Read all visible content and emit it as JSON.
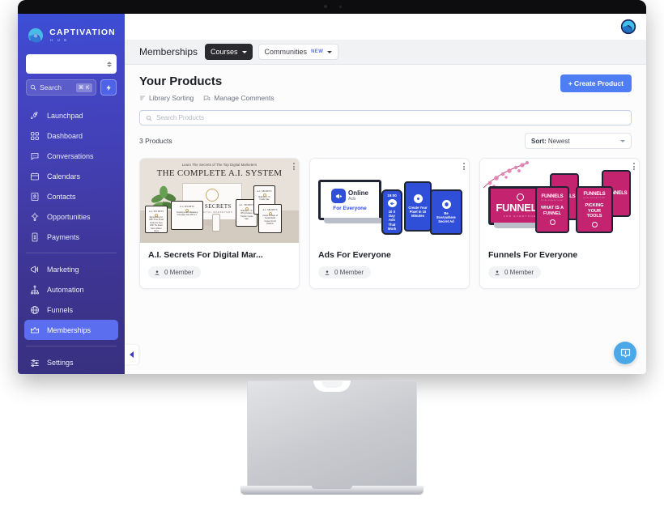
{
  "sidebar": {
    "brand": {
      "name": "CAPTIVATION",
      "sub": "H U B",
      "logo_icon": "captivation-leaf-logo"
    },
    "org_select": {
      "value": "",
      "icon": "spinner-arrows-icon"
    },
    "search": {
      "label": "Search",
      "shortcut": "⌘ K",
      "icon": "search-icon"
    },
    "quick_action": {
      "icon": "lightning-bolt-icon"
    },
    "items": [
      {
        "label": "Launchpad",
        "icon": "rocket-icon",
        "active": false
      },
      {
        "label": "Dashboard",
        "icon": "grid-icon",
        "active": false
      },
      {
        "label": "Conversations",
        "icon": "chat-bubble-icon",
        "active": false
      },
      {
        "label": "Calendars",
        "icon": "calendar-icon",
        "active": false
      },
      {
        "label": "Contacts",
        "icon": "contact-card-icon",
        "active": false
      },
      {
        "label": "Opportunities",
        "icon": "target-bulb-icon",
        "active": false
      },
      {
        "label": "Payments",
        "icon": "payment-icon",
        "active": false
      }
    ],
    "items2": [
      {
        "label": "Marketing",
        "icon": "megaphone-icon",
        "active": false
      },
      {
        "label": "Automation",
        "icon": "workflow-icon",
        "active": false
      },
      {
        "label": "Funnels",
        "icon": "globe-icon",
        "active": false
      },
      {
        "label": "Memberships",
        "icon": "crown-icon",
        "active": true
      }
    ],
    "items3": [
      {
        "label": "Settings",
        "icon": "sliders-icon",
        "active": false
      }
    ],
    "active_color": "#5b6ef0"
  },
  "topbar": {
    "app_logo_icon": "captivation-circle-logo"
  },
  "tabbar": {
    "title": "Memberships",
    "tabs": [
      {
        "label": "Courses",
        "active": true,
        "badge": "",
        "icon": "chevron-down-icon"
      },
      {
        "label": "Communities",
        "active": false,
        "badge": "NEW",
        "icon": "chevron-down-icon"
      }
    ]
  },
  "page": {
    "title": "Your Products",
    "sub_actions": [
      {
        "label": "Library Sorting",
        "icon": "library-sort-icon"
      },
      {
        "label": "Manage Comments",
        "icon": "comments-icon"
      }
    ],
    "create_button": "+ Create Product",
    "search_placeholder": "Search Products",
    "search_value": "",
    "search_icon": "search-icon",
    "count_label": "3 Products",
    "sort": {
      "prefix": "Sort:",
      "value": "Newest",
      "icon": "chevron-down-icon"
    }
  },
  "products": [
    {
      "title": "A.I. Secrets For Digital Mar...",
      "members": "0 Member",
      "member_icon": "person-icon",
      "menu_icon": "more-vertical-icon",
      "thumb": {
        "style": "ai-system",
        "kicker": "Learn The Secrets of The Top Digital Marketers",
        "headline": "THE COMPLETE A.I. SYSTEM",
        "monitor_title": "A.I. SECRETS",
        "monitor_sub": "FOR DIGITAL MARKETERS",
        "tablets": [
          {
            "title": "A.I. SECRETS",
            "body": "Skyrocketing A.I. With Three Small Clicks For Sure With The Exact Same Master Alerts"
          },
          {
            "title": "A.I. SECRETS",
            "body": "Creating Leads Marketing Campaign Fast With A.I."
          },
          {
            "title": "A.I. SECRETS",
            "body": "Making A.I. To Wing Creative Traction Create Sale"
          },
          {
            "title": "A.I. SECRETS",
            "body": "Making A.I. To Create Sale"
          },
          {
            "title": "A.I. SECRETS",
            "body": "Create 30 Days of Social Media Content for All Platform"
          }
        ]
      }
    },
    {
      "title": "Ads For Everyone",
      "members": "0 Member",
      "member_icon": "person-icon",
      "menu_icon": "more-vertical-icon",
      "thumb": {
        "style": "ads",
        "laptop_line1": "Online",
        "laptop_line2": "Ads",
        "laptop_line3": "For Everyone",
        "devices": [
          {
            "time": "19:00",
            "caption": "10 X Day Ads That Work"
          },
          {
            "time": "",
            "caption": "Create Your Pixel In 10 Minutes"
          },
          {
            "time": "",
            "caption": "Be Everywhere Secret Ad"
          }
        ]
      }
    },
    {
      "title": "Funnels For Everyone",
      "members": "0 Member",
      "member_icon": "person-icon",
      "menu_icon": "more-vertical-icon",
      "thumb": {
        "style": "funnels",
        "word": "FUNNELS",
        "word_sub": "FOR EVERYONE",
        "devices": [
          {
            "word": "FUNNELS",
            "sub": "FOR EVERYONE",
            "msg": "WHAT IS A FUNNEL"
          },
          {
            "word": "FUNNELS",
            "sub": "FOR EVERYONE",
            "msg": "PICKING YOUR TOOLS"
          },
          {
            "word": "FUNNELS",
            "sub": "",
            "msg": ""
          },
          {
            "word": "FUNNELS",
            "sub": "",
            "msg": ""
          }
        ]
      }
    }
  ],
  "collapse_button": {
    "icon": "chevron-left-icon"
  },
  "chat_widget": {
    "icon": "chat-info-bubble-icon",
    "color": "#4aa8e8"
  }
}
